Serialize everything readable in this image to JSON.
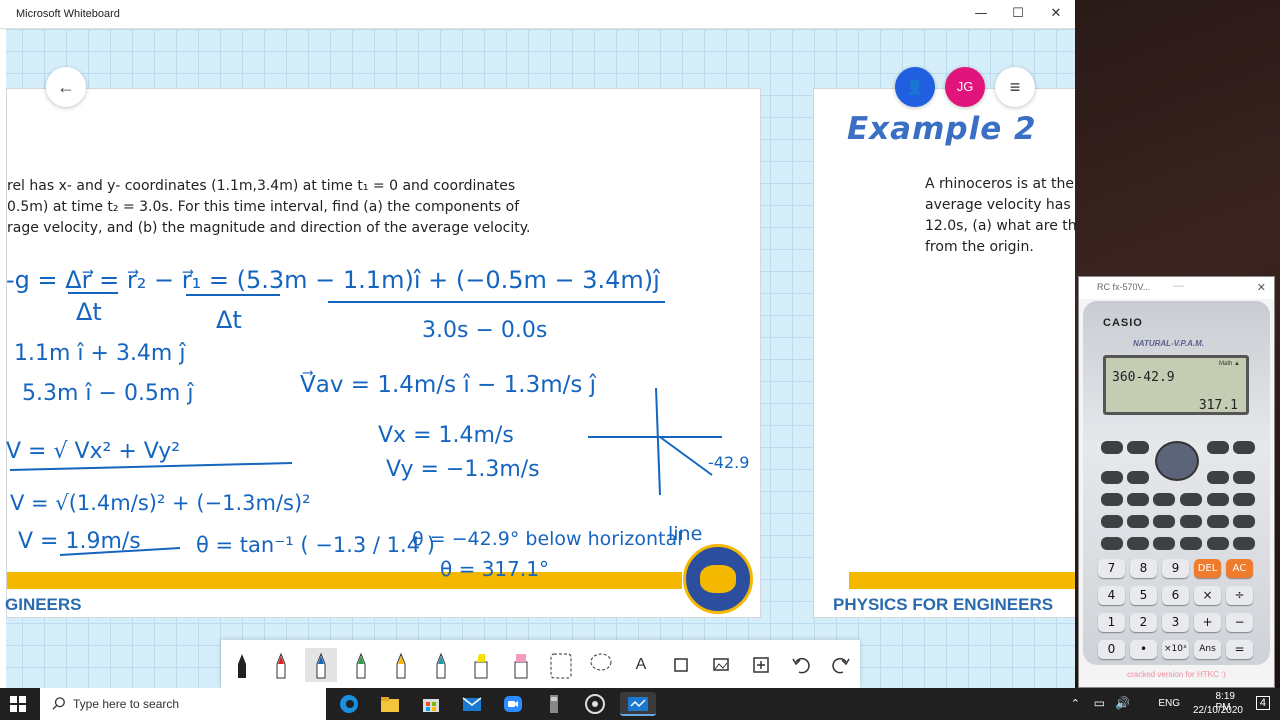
{
  "window": {
    "title": "Microsoft Whiteboard",
    "minimize": "—",
    "maximize": "☐",
    "close": "✕"
  },
  "controls": {
    "back": "←",
    "share": "👤",
    "avatar_initials": "JG",
    "menu": "≡"
  },
  "slide1": {
    "problem_lines": [
      "rel has x- and y- coordinates (1.1m,3.4m) at time t₁ = 0 and coordinates",
      "0.5m) at time t₂ = 3.0s. For this time interval, find (a) the components of",
      "rage velocity, and (b) the magnitude and direction of the average velocity."
    ],
    "footer": "GINEERS",
    "logo_text": "PANGASINAN STATE UNIVERSITY 1979"
  },
  "slide2": {
    "title": "Example 2",
    "problem_lines": [
      "A rhinoceros is at the",
      "average velocity has x",
      "12.0s, (a) what are th",
      "from the origin."
    ],
    "footer": "PHYSICS FOR ENGINEERS"
  },
  "ink": {
    "line1": "-g =  Δr⃗  =  r⃗₂ − r⃗₁  =  (5.3m − 1.1m)î  + (−0.5m − 3.4m)ĵ",
    "dt1": "Δt",
    "dt2": "Δt",
    "denom": "3.0s − 0.0s",
    "r1": "1.1m î + 3.4m ĵ",
    "r2": "5.3m î − 0.5m ĵ",
    "vav": "V⃗av = 1.4m/s î − 1.3m/s ĵ",
    "vx": "Vx = 1.4m/s",
    "vy": "Vy = −1.3m/s",
    "vmag": "V = √ Vx² + Vy²",
    "vnum": "V = √(1.4m/s)² + (−1.3m/s)²",
    "vres": "V = 1.9m/s",
    "theta": "θ = tan⁻¹ ( −1.3 / 1.4 )",
    "theta_deg": "θ = −42.9°  below horizontal",
    "theta_line": "line",
    "theta_full": "θ = 317.1°",
    "angle_label": "-42.9"
  },
  "toolbar": {
    "tools": [
      "black-pen",
      "red-pen",
      "blue-pen",
      "green-pen",
      "yellow-pen",
      "teal-pen",
      "highlighter-yellow",
      "highlighter-pink",
      "lasso",
      "eraser-lasso",
      "text",
      "sticky-note",
      "image",
      "add",
      "undo",
      "redo"
    ]
  },
  "calculator": {
    "window_title": "RC fx-570V...",
    "brand": "CASIO",
    "model": "NATURAL-V.P.A.M.",
    "mode": "Math ▲",
    "expression": "360-42.9",
    "result": "317.1",
    "footer": "cracked version for HTKC :)",
    "keys_row1": [
      "7",
      "8",
      "9",
      "DEL",
      "AC"
    ],
    "keys_row2": [
      "4",
      "5",
      "6",
      "×",
      "÷"
    ],
    "keys_row3": [
      "1",
      "2",
      "3",
      "+",
      "−"
    ],
    "keys_row4": [
      "0",
      "•",
      "×10ˣ",
      "Ans",
      "="
    ]
  },
  "taskbar": {
    "search_placeholder": "Type here to search",
    "lang": "ENG",
    "time": "8:19 PM",
    "date": "22/10/2020",
    "notifications": "4"
  }
}
